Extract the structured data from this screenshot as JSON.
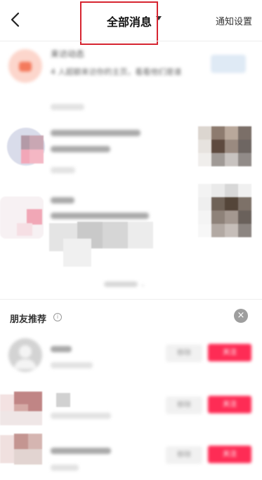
{
  "header": {
    "title": "全部消息",
    "settings_label": "通知设置",
    "back_icon": "chevron-left-icon"
  },
  "messages": [
    {
      "title": "来访动态",
      "text": "4 人超额来访你的主页，看看他们是谁"
    },
    {
      "title": "",
      "text": ""
    },
    {
      "title": "",
      "text": ""
    }
  ],
  "fold_label": "",
  "friends": {
    "section_title": "朋友推荐",
    "info_icon": "info-icon",
    "close_icon": "close-icon",
    "items": [
      {
        "name": "",
        "remove_label": "移除",
        "follow_label": "关注"
      },
      {
        "name": "",
        "remove_label": "移除",
        "follow_label": "关注"
      },
      {
        "name": "",
        "remove_label": "移除",
        "follow_label": "关注"
      }
    ]
  },
  "colors": {
    "accent": "#fe2c55",
    "highlight_box": "#d62430"
  }
}
